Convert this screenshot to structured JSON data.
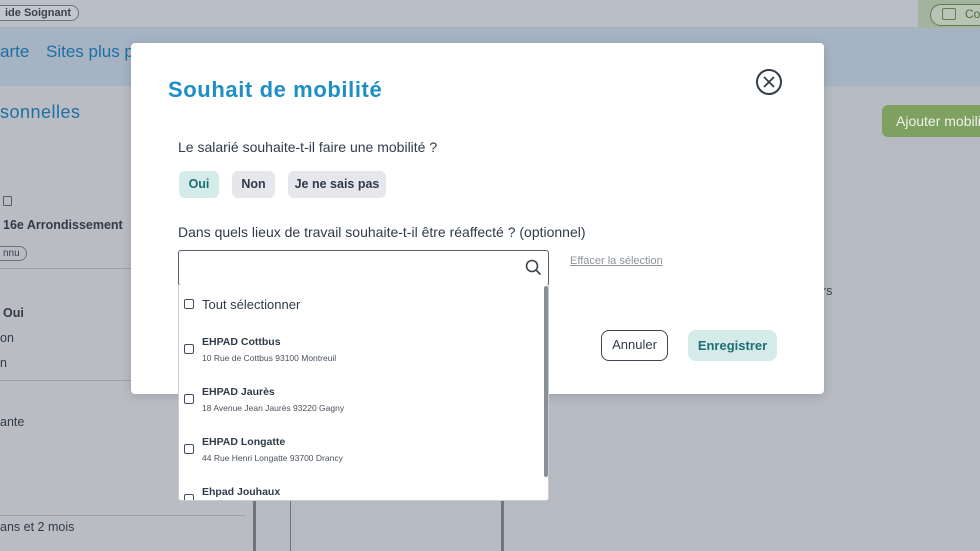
{
  "background": {
    "badge": "ide Soignant",
    "co_button": "Co",
    "nav": [
      "arte",
      "Sites plus p"
    ],
    "section_title": "sonnelles",
    "address": "16e Arrondissement",
    "pill": "nnu",
    "rows": [
      "Oui",
      "on",
      "n",
      "ante",
      "ans et 2 mois"
    ],
    "add_button": "Ajouter mobilit",
    "right_text": "rs"
  },
  "modal": {
    "title": "Souhait de mobilité",
    "question1": "Le salarié souhaite-t-il faire une mobilité ?",
    "choices": [
      {
        "label": "Oui",
        "active": true
      },
      {
        "label": "Non",
        "active": false
      },
      {
        "label": "Je ne sais pas",
        "active": false
      }
    ],
    "question2": "Dans quels lieux de travail souhaite-t-il être réaffecté ? (optionnel)",
    "search": {
      "value": "",
      "placeholder": ""
    },
    "clear_link": "Effacer la sélection",
    "cancel": "Annuler",
    "save": "Enregistrer"
  },
  "dropdown": {
    "select_all": "Tout sélectionner",
    "items": [
      {
        "name": "EHPAD Cottbus",
        "address": "10 Rue de Cottbus 93100 Montreuil"
      },
      {
        "name": "EHPAD Jaurès",
        "address": "18 Avenue Jean Jaurès 93220 Gagny"
      },
      {
        "name": "EHPAD Longatte",
        "address": "44 Rue Henri Longatte 93700 Drancy"
      },
      {
        "name": "Ehpad Jouhaux",
        "address": ""
      }
    ]
  },
  "colors": {
    "accent": "#1e8fc4",
    "selected_bg": "#d4ebea",
    "selected_text": "#1e6f73",
    "add_button_bg": "#7ea061"
  }
}
